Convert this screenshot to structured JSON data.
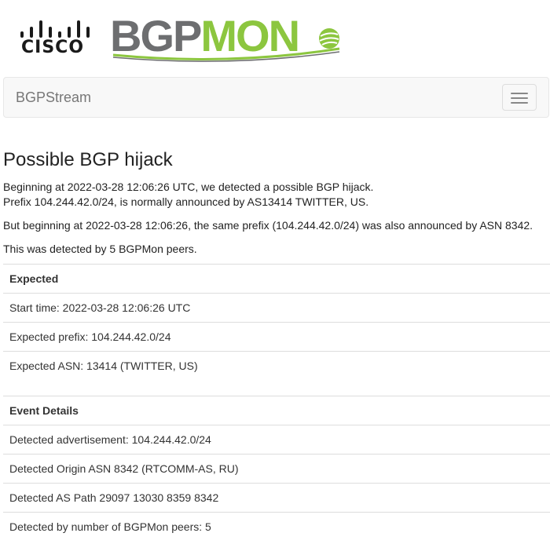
{
  "brand": {
    "cisco_wordmark": "CISCO",
    "bgpmon_part1": "BGP",
    "bgpmon_part2": "MON",
    "colors": {
      "bgp_gray": "#6d6e70",
      "mon_green": "#8cc63f"
    }
  },
  "navbar": {
    "brand": "BGPStream",
    "toggle_icon": "hamburger-menu-icon"
  },
  "alert": {
    "title": "Possible BGP hijack",
    "line1": "Beginning at 2022-03-28 12:06:26 UTC, we detected a possible BGP hijack.",
    "line2": "Prefix 104.244.42.0/24, is normally announced by AS13414 TWITTER, US.",
    "line3": "But beginning at 2022-03-28 12:06:26, the same prefix (104.244.42.0/24) was also announced by ASN 8342.",
    "line4": "This was detected by 5 BGPMon peers."
  },
  "expected": {
    "header": "Expected",
    "rows": [
      "Start time: 2022-03-28 12:06:26 UTC",
      "Expected prefix: 104.244.42.0/24",
      "Expected ASN: 13414 (TWITTER, US)"
    ]
  },
  "event_details": {
    "header": "Event Details",
    "rows": [
      "Detected advertisement: 104.244.42.0/24",
      "Detected Origin ASN 8342 (RTCOMM-AS, RU)",
      "Detected AS Path 29097 13030 8359 8342",
      "Detected by number of BGPMon peers: 5"
    ]
  }
}
